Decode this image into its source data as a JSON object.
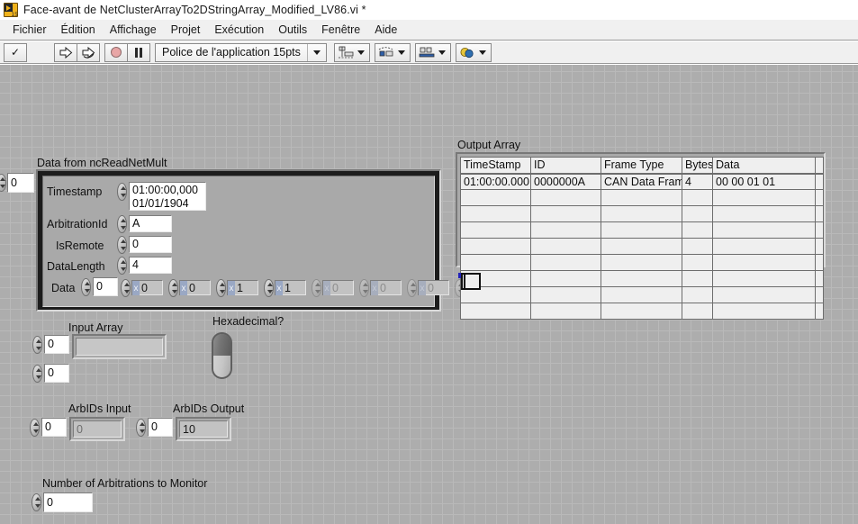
{
  "window": {
    "title": "Face-avant de NetClusterArrayTo2DStringArray_Modified_LV86.vi *",
    "icon": "labview-vi-icon",
    "icon_badge": "15"
  },
  "menubar": {
    "items": [
      {
        "label": "Fichier"
      },
      {
        "label": "Édition"
      },
      {
        "label": "Affichage"
      },
      {
        "label": "Projet"
      },
      {
        "label": "Exécution"
      },
      {
        "label": "Outils"
      },
      {
        "label": "Fenêtre"
      },
      {
        "label": "Aide"
      }
    ]
  },
  "toolbar": {
    "run_icon": "run-arrow-icon",
    "run_continuous_icon": "run-continuously-icon",
    "abort_icon": "abort-execution-icon",
    "pause_icon": "pause-icon",
    "broken_run_icon": "check-mark-icon",
    "font_label": "Police de l'application 15pts",
    "align_icon": "align-objects-icon",
    "distribute_icon": "distribute-objects-icon",
    "resize_icon": "resize-objects-icon",
    "reorder_icon": "reorder-objects-icon",
    "dropdown_icon": "chevron-down-icon"
  },
  "panel": {
    "cluster_array": {
      "label": "Data from ncReadNetMult",
      "index_value": "0",
      "fields": [
        {
          "label": "Timestamp",
          "value": "01:00:00,000\n01/01/1904"
        },
        {
          "label": "ArbitrationId",
          "value": "A"
        },
        {
          "label": "IsRemote",
          "value": "0"
        },
        {
          "label": "DataLength",
          "value": "4"
        }
      ],
      "timestamp_line1": "01:00:00,000",
      "timestamp_line2": "01/01/1904",
      "data": {
        "label": "Data",
        "index_value": "0",
        "radix": "x",
        "elements": [
          {
            "value": "0",
            "active": true
          },
          {
            "value": "0",
            "active": true
          },
          {
            "value": "1",
            "active": true
          },
          {
            "value": "1",
            "active": true
          },
          {
            "value": "0",
            "active": false
          },
          {
            "value": "0",
            "active": false
          },
          {
            "value": "0",
            "active": false
          },
          {
            "value": "0",
            "active": false
          }
        ]
      }
    },
    "input_array": {
      "label": "Input Array",
      "index_row": "0",
      "index_col": "0",
      "value": ""
    },
    "hexadecimal": {
      "label": "Hexadecimal?",
      "state": "off"
    },
    "arbids_input": {
      "label": "ArbIDs Input",
      "index_value": "0",
      "value": "0"
    },
    "arbids_output": {
      "label": "ArbIDs Output",
      "index_value": "0",
      "value": "10"
    },
    "num_arbitrations": {
      "label": "Number of Arbitrations to Monitor",
      "index_value": "0"
    },
    "output_array": {
      "label": "Output Array",
      "columns": [
        "TimeStamp",
        "ID",
        "Frame Type",
        "Bytes",
        "Data",
        ""
      ],
      "rows": [
        [
          "01:00:00.000",
          "0000000A",
          "CAN Data Fram",
          "4",
          "00 00 01 01",
          ""
        ],
        [
          "",
          "",
          "",
          "",
          "",
          ""
        ],
        [
          "",
          "",
          "",
          "",
          "",
          ""
        ],
        [
          "",
          "",
          "",
          "",
          "",
          ""
        ],
        [
          "",
          "",
          "",
          "",
          "",
          ""
        ],
        [
          "",
          "",
          "",
          "",
          "",
          ""
        ],
        [
          "",
          "",
          "",
          "",
          "",
          ""
        ],
        [
          "",
          "",
          "",
          "",
          "",
          ""
        ],
        [
          "",
          "",
          "",
          "",
          "",
          ""
        ]
      ],
      "edit_cursor_row": 5,
      "edit_cursor_col": 0
    }
  },
  "colors": {
    "panel_bg": "#adadad",
    "grid_line": "#b9b9b9",
    "cluster_bg": "#1c1c1c",
    "field_bg": "#ffffff",
    "dim_text": "#6e6e6e",
    "radix_bg": "#9aa8c4",
    "table_bg": "#efefef"
  }
}
